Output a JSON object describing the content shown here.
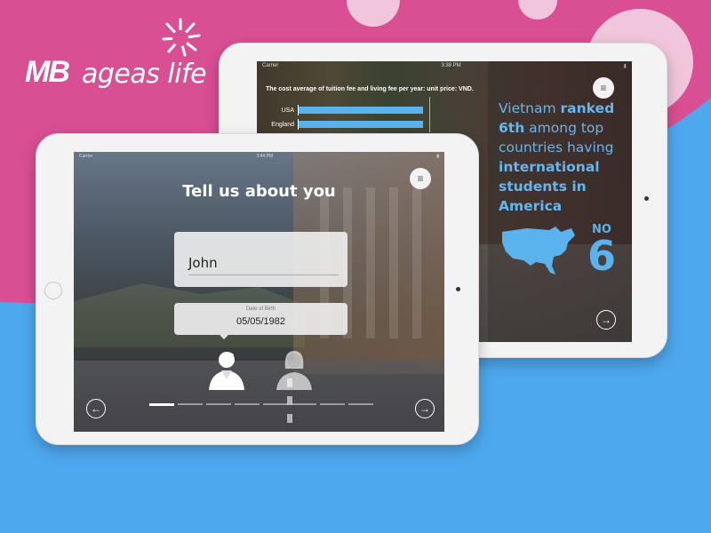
{
  "brand": {
    "logo_mb": "MB",
    "logo_text": "ageas life",
    "pink": "#d94f93",
    "blue": "#4ea8ee"
  },
  "back_screen": {
    "status_left": "Carrier",
    "status_time": "3:38 PM",
    "chart": {
      "title": "The cost average of tuition fee and living fee per year: unit price: VND.",
      "rows": [
        {
          "label": "USA",
          "fill": 0.98
        },
        {
          "label": "England",
          "fill": 0.98
        }
      ]
    },
    "fact": {
      "part1": "Vietnam ",
      "part2": "ranked",
      "part3": " ",
      "part4": "6th",
      "part5": " among top countries having ",
      "part6": "international students in America"
    },
    "badge_label": "NO",
    "badge_number": "6",
    "menu_icon": "hamburger-icon",
    "next_icon": "arrow-right-icon"
  },
  "front_screen": {
    "status_left": "Carrier",
    "status_time": "3:44 PM",
    "title": "Tell us about you",
    "name_value": "John",
    "dob_label": "Date of Birth",
    "dob_value": "05/05/1982",
    "progress_total": 8,
    "progress_current": 1,
    "menu_icon": "hamburger-icon",
    "prev_icon": "arrow-left-icon",
    "next_icon": "arrow-right-icon"
  }
}
